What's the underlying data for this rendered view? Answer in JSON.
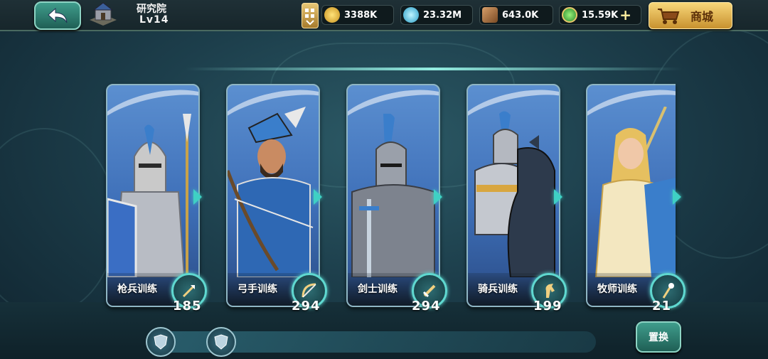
{
  "header": {
    "building_name": "研究院",
    "building_level": "Lv14",
    "shop_label": "商城"
  },
  "resources": [
    {
      "name": "gold",
      "icon": "gold-coins-icon",
      "value": "3388K"
    },
    {
      "name": "mana",
      "icon": "potion-flask-icon",
      "value": "23.32M"
    },
    {
      "name": "wood",
      "icon": "wood-log-icon",
      "value": "643.0K"
    },
    {
      "name": "gems",
      "icon": "green-gem-coin-icon",
      "value": "15.59K"
    }
  ],
  "cards": [
    {
      "label": "枪兵训练",
      "count": "185",
      "icon": "spear-icon",
      "accent": "#c9c9c9"
    },
    {
      "label": "弓手训练",
      "count": "294",
      "icon": "bow-icon",
      "accent": "#3a7ecb"
    },
    {
      "label": "剑士训练",
      "count": "294",
      "icon": "sword-icon",
      "accent": "#8a8f98"
    },
    {
      "label": "骑兵训练",
      "count": "199",
      "icon": "horse-head-icon",
      "accent": "#2d3a4c"
    },
    {
      "label": "牧师训练",
      "count": "21",
      "icon": "staff-icon",
      "accent": "#f3e7c0"
    }
  ],
  "bottom": {
    "swap_label": "置换"
  },
  "colors": {
    "accent_teal": "#3fd0c4",
    "shop_gold": "#f8d779",
    "card_blue": "#3e6fb8"
  }
}
